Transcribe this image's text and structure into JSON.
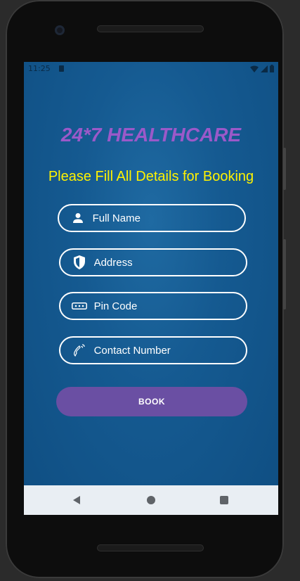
{
  "status_bar": {
    "time": "11:25"
  },
  "app": {
    "title": "24*7 HEALTHCARE",
    "subtitle": "Please Fill All Details for Booking",
    "title_color": "#9b59c9",
    "subtitle_color": "#fff200",
    "background_color": "#155a91"
  },
  "form": {
    "full_name": {
      "placeholder": "Full Name",
      "value": "",
      "icon": "person-icon"
    },
    "address": {
      "placeholder": "Address",
      "value": "",
      "icon": "shield-icon"
    },
    "pin_code": {
      "placeholder": "Pin Code",
      "value": "",
      "icon": "password-dots-icon"
    },
    "contact": {
      "placeholder": "Contact Number",
      "value": "",
      "icon": "phone-icon"
    },
    "book_label": "BOOK",
    "book_color": "#6a4fa3"
  },
  "nav": {
    "back": "back-icon",
    "home": "home-icon",
    "recents": "recents-icon"
  }
}
